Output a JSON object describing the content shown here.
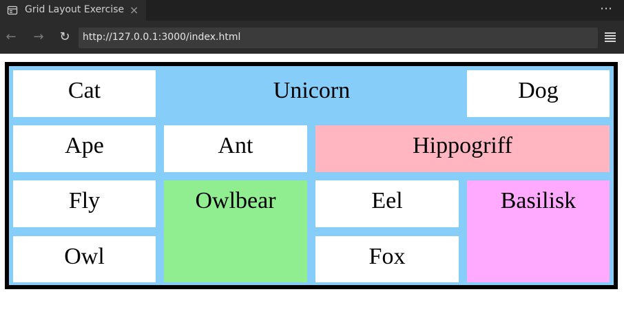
{
  "browser": {
    "tab_title": "Grid Layout Exercise",
    "tab_close": "×",
    "overflow_menu": "⋯",
    "url": "http://127.0.0.1:3000/index.html",
    "back": "←",
    "forward": "→",
    "reload": "↻"
  },
  "grid": {
    "background": "#87cdf9",
    "border_color": "#000000",
    "cells": [
      {
        "label": "Cat",
        "color": "#ffffff"
      },
      {
        "label": "Unicorn",
        "color": "#87cdf9"
      },
      {
        "label": "Dog",
        "color": "#ffffff"
      },
      {
        "label": "Ape",
        "color": "#ffffff"
      },
      {
        "label": "Ant",
        "color": "#ffffff"
      },
      {
        "label": "Hippogriff",
        "color": "#ffb6c1"
      },
      {
        "label": "Fly",
        "color": "#ffffff"
      },
      {
        "label": "Owlbear",
        "color": "#90ee90"
      },
      {
        "label": "Eel",
        "color": "#ffffff"
      },
      {
        "label": "Basilisk",
        "color": "#ffaaff"
      },
      {
        "label": "Owl",
        "color": "#ffffff"
      },
      {
        "label": "Fox",
        "color": "#ffffff"
      }
    ]
  }
}
